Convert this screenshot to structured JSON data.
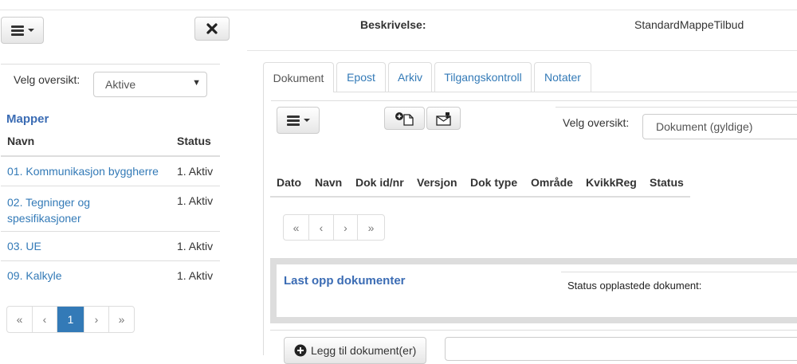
{
  "header": {
    "beskrivelse_label": "Beskrivelse:",
    "beskrivelse_value": "StandardMappeTilbud"
  },
  "left": {
    "velg_label": "Velg oversikt:",
    "velg_selected": "Aktive",
    "mapper_title": "Mapper",
    "col_navn": "Navn",
    "col_status": "Status",
    "rows": [
      {
        "name": "01. Kommunikasjon byggherre",
        "status": "1. Aktiv"
      },
      {
        "name": "02. Tegninger og spesifikasjoner",
        "status": "1. Aktiv"
      },
      {
        "name": "03. UE",
        "status": "1. Aktiv"
      },
      {
        "name": "09. Kalkyle",
        "status": "1. Aktiv"
      }
    ],
    "pager": [
      "«",
      "‹",
      "1",
      "›",
      "»"
    ]
  },
  "tabs": [
    "Dokument",
    "Epost",
    "Arkiv",
    "Tilgangskontroll",
    "Notater"
  ],
  "main": {
    "velg_label": "Velg oversikt:",
    "velg_selected": "Dokument (gyldige)",
    "columns": [
      "Dato",
      "Navn",
      "Dok id/nr",
      "Versjon",
      "Dok type",
      "Område",
      "KvikkReg",
      "Status"
    ],
    "pager": [
      "«",
      "‹",
      "›",
      "»"
    ],
    "upload_title": "Last opp dokumenter",
    "upload_status": "Status opplastede dokument:",
    "add_button": "Legg til dokument(er)"
  },
  "colors": {
    "accent": "#337ab7",
    "panel_border": "#ddd"
  }
}
